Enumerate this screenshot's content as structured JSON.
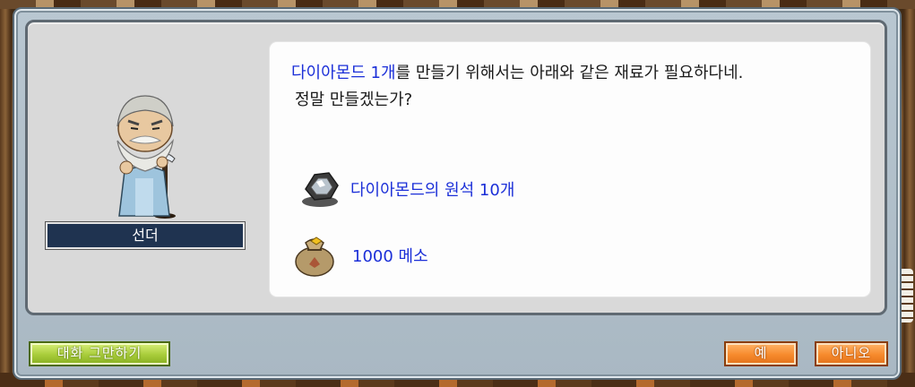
{
  "npc": {
    "name": "선더",
    "portrait_icon": "old-bearded-man-with-cane"
  },
  "dialog": {
    "item_name": "다이아몬드 1개",
    "line1_rest": "를 만들기 위해서는 아래와 같은 재료가 필요하다네.",
    "line2": "정말 만들겠는가?"
  },
  "requirements": [
    {
      "icon": "diamond-ore-icon",
      "label": "다이아몬드의 원석 10개"
    },
    {
      "icon": "meso-bag-icon",
      "label": "1000 메소"
    }
  ],
  "buttons": {
    "end_chat": "대화 그만하기",
    "yes": "예",
    "no": "아니오"
  },
  "colors": {
    "highlight_text": "#1b2fd8",
    "end_button": "#a8cc3a",
    "confirm_buttons": "#f78a2c",
    "name_plate": "#1f3350"
  }
}
